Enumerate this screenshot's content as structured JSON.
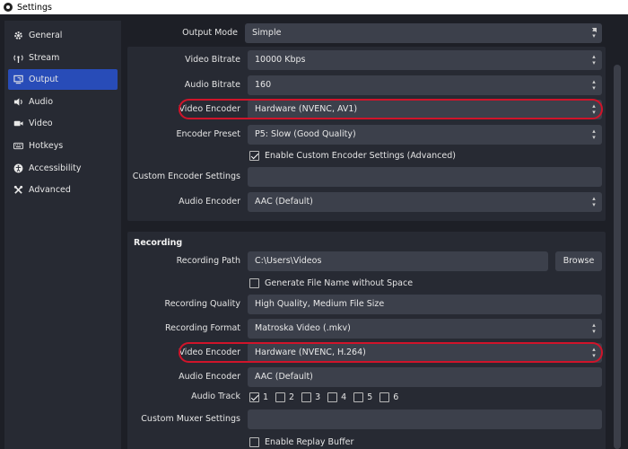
{
  "window": {
    "title": "Settings"
  },
  "sidebar": {
    "items": [
      {
        "label": "General",
        "icon": "gear-icon",
        "active": false
      },
      {
        "label": "Stream",
        "icon": "antenna-icon",
        "active": false
      },
      {
        "label": "Output",
        "icon": "monitor-output-icon",
        "active": true
      },
      {
        "label": "Audio",
        "icon": "speaker-icon",
        "active": false
      },
      {
        "label": "Video",
        "icon": "camera-icon",
        "active": false
      },
      {
        "label": "Hotkeys",
        "icon": "keyboard-icon",
        "active": false
      },
      {
        "label": "Accessibility",
        "icon": "accessibility-icon",
        "active": false
      },
      {
        "label": "Advanced",
        "icon": "wrench-icon",
        "active": false
      }
    ]
  },
  "output_mode": {
    "label": "Output Mode",
    "value": "Simple"
  },
  "streaming": {
    "video_bitrate": {
      "label": "Video Bitrate",
      "value": "10000 Kbps"
    },
    "audio_bitrate": {
      "label": "Audio Bitrate",
      "value": "160"
    },
    "video_encoder": {
      "label": "Video Encoder",
      "value": "Hardware (NVENC, AV1)"
    },
    "encoder_preset": {
      "label": "Encoder Preset",
      "value": "P5: Slow (Good Quality)"
    },
    "enable_custom": {
      "label": "Enable Custom Encoder Settings (Advanced)",
      "checked": true
    },
    "custom_settings": {
      "label": "Custom Encoder Settings",
      "value": ""
    },
    "audio_encoder": {
      "label": "Audio Encoder",
      "value": "AAC (Default)"
    }
  },
  "recording": {
    "title": "Recording",
    "path": {
      "label": "Recording Path",
      "value": "C:\\Users\\Videos",
      "browse_label": "Browse"
    },
    "no_space": {
      "label": "Generate File Name without Space",
      "checked": false
    },
    "quality": {
      "label": "Recording Quality",
      "value": "High Quality, Medium File Size"
    },
    "format": {
      "label": "Recording Format",
      "value": "Matroska Video (.mkv)"
    },
    "video_encoder": {
      "label": "Video Encoder",
      "value": "Hardware (NVENC, H.264)"
    },
    "audio_encoder": {
      "label": "Audio Encoder",
      "value": "AAC (Default)"
    },
    "audio_track": {
      "label": "Audio Track",
      "tracks": [
        "1",
        "2",
        "3",
        "4",
        "5",
        "6"
      ],
      "checked": [
        true,
        false,
        false,
        false,
        false,
        false
      ]
    },
    "muxer": {
      "label": "Custom Muxer Settings",
      "value": ""
    },
    "replay_buffer": {
      "label": "Enable Replay Buffer",
      "checked": false
    }
  },
  "colors": {
    "accent": "#284cb8",
    "highlight": "#d0142a"
  }
}
